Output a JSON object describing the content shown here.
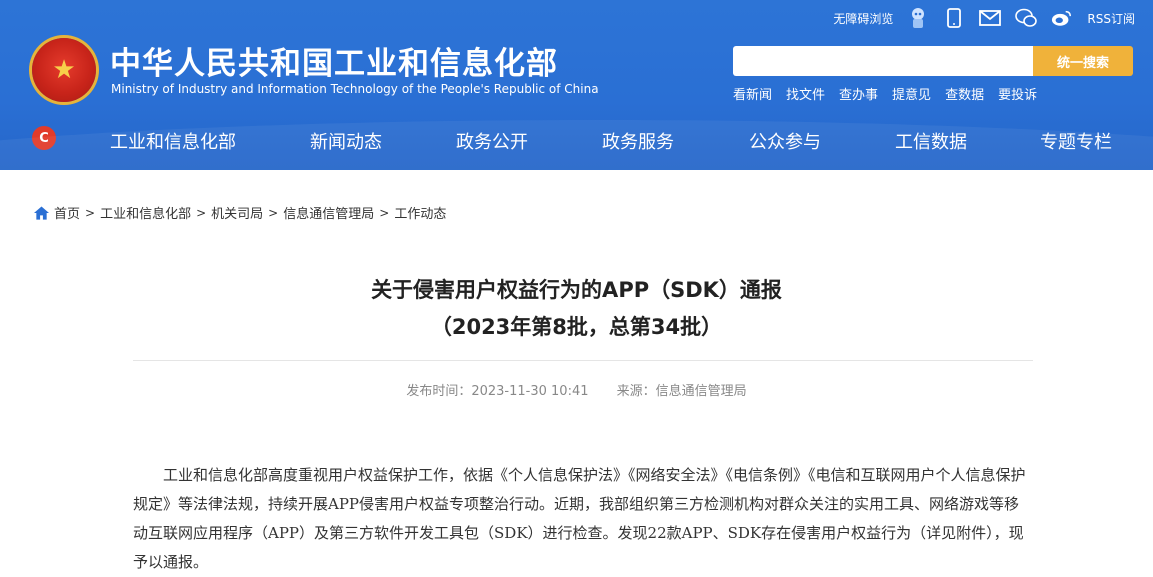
{
  "topbar": {
    "accessible": "无障碍浏览",
    "rss": "RSS订阅"
  },
  "site": {
    "title_cn": "中华人民共和国工业和信息化部",
    "title_en": "Ministry of Industry and Information Technology of the People's Republic of China"
  },
  "search": {
    "placeholder": "",
    "button": "统一搜索"
  },
  "quick_links": [
    "看新闻",
    "找文件",
    "查办事",
    "提意见",
    "查数据",
    "要投诉"
  ],
  "nav": [
    "工业和信息化部",
    "新闻动态",
    "政务公开",
    "政务服务",
    "公众参与",
    "工信数据",
    "专题专栏"
  ],
  "breadcrumb": [
    "首页",
    "工业和信息化部",
    "机关司局",
    "信息通信管理局",
    "工作动态"
  ],
  "article": {
    "title_line1": "关于侵害用户权益行为的APP（SDK）通报",
    "title_line2": "（2023年第8批，总第34批）",
    "publish_time": "发布时间：2023-11-30 10:41",
    "source": "来源：信息通信管理局",
    "paragraph": "工业和信息化部高度重视用户权益保护工作，依据《个人信息保护法》《网络安全法》《电信条例》《电信和互联网用户个人信息保护规定》等法律法规，持续开展APP侵害用户权益专项整治行动。近期，我部组织第三方检测机构对群众关注的实用工具、网络游戏等移动互联网应用程序（APP）及第三方软件开发工具包（SDK）进行检查。发现22款APP、SDK存在侵害用户权益行为（详见附件），现予以通报。"
  },
  "colors": {
    "header_blue": "#2a6fd4",
    "search_button": "#f0b23a",
    "emblem_red": "#c8241a"
  }
}
